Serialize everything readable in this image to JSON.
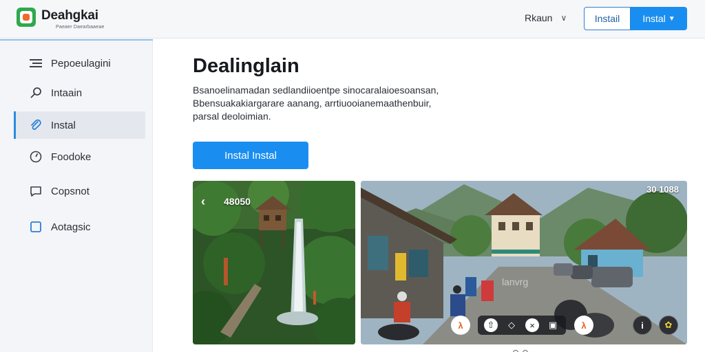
{
  "header": {
    "app_name": "Deahgkai",
    "tagline": "Paeaer Daearbaaeae",
    "account_label": "Rkaun",
    "install_outline_label": "Instail",
    "install_primary_label": "Instal"
  },
  "sidebar": {
    "items": [
      {
        "label": "Pepoeulagini",
        "icon": "menu-icon",
        "active": false
      },
      {
        "label": "Intaain",
        "icon": "search-icon",
        "active": false
      },
      {
        "label": "Instal",
        "icon": "paperclip-icon",
        "active": true
      },
      {
        "label": "Foodoke",
        "icon": "compass-icon",
        "active": false
      },
      {
        "label": "Copsnot",
        "icon": "chat-icon",
        "active": false
      },
      {
        "label": "Aotagsic",
        "icon": "square-icon",
        "active": false
      }
    ]
  },
  "main": {
    "title": "Dealinglain",
    "description_lines": [
      "Bsanoelinamadan sedlandiioentpe sinocaralaioesoansan,",
      "Bbensuakakiargarare aanang, arrtiuooianemaathenbuir,",
      "parsal deoloimian."
    ],
    "install_button_label": "Instal Instal"
  },
  "screenshots": {
    "first": {
      "overlay_label": "48050"
    },
    "second": {
      "overlay_label": "30 1088",
      "watermark": "lanvrg"
    }
  },
  "colors": {
    "accent": "#1a8ef0",
    "brand_green": "#2fa84f",
    "sidebar_bg": "#f3f5f8"
  }
}
